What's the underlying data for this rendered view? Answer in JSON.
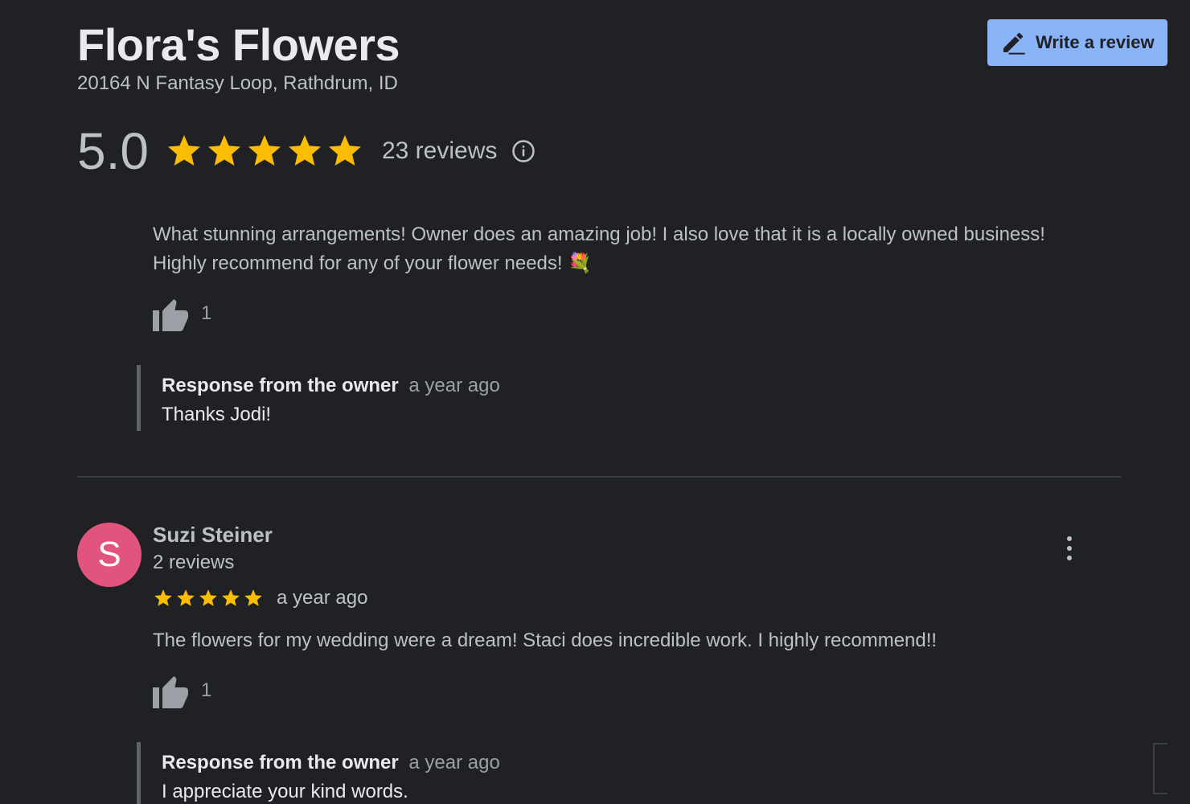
{
  "business": {
    "name": "Flora's Flowers",
    "address": "20164 N Fantasy Loop, Rathdrum, ID"
  },
  "actions": {
    "write_review_label": "Write a review",
    "write_review_icon": "pencil-icon"
  },
  "summary": {
    "average": "5.0",
    "stars": 5,
    "review_count": "23 reviews",
    "info_icon": "info-icon",
    "star_color": "#fbbc04"
  },
  "reviews": [
    {
      "text_line1": "What stunning arrangements! Owner does an amazing job! I also love that it is a locally owned business!",
      "text_line2": "Highly recommend for any of your flower needs! 💐",
      "likes": "1",
      "response": {
        "label": "Response from the owner",
        "time": "a year ago",
        "text": "Thanks Jodi!"
      }
    },
    {
      "reviewer_initial": "S",
      "reviewer_name": "Suzi Steiner",
      "reviewer_review_count": "2 reviews",
      "rating": 5,
      "time": "a year ago",
      "text": "The flowers for my wedding were a dream! Staci does incredible work. I highly recommend!!",
      "likes": "1",
      "avatar_color": "#e0547e",
      "response": {
        "label": "Response from the owner",
        "time": "a year ago",
        "text": "I appreciate your kind words."
      }
    }
  ]
}
